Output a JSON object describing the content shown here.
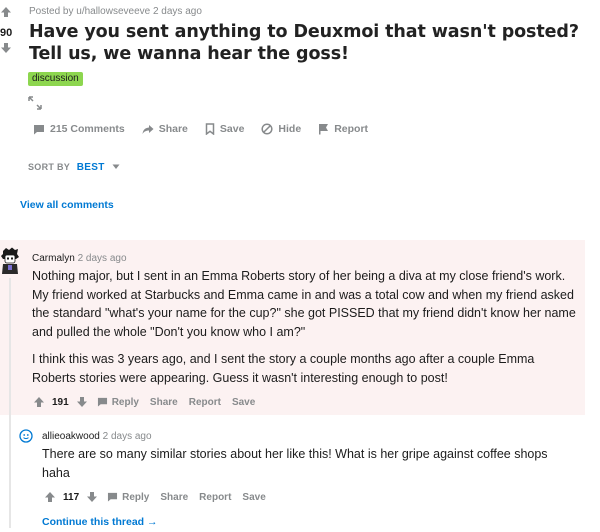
{
  "post": {
    "score": "90",
    "meta": "Posted by u/hallowseveeve 2 days ago",
    "title": "Have you sent anything to Deuxmoi that wasn't posted? Tell us, we wanna hear the goss!",
    "flair": "discussion",
    "flair_color": "#8dd64f",
    "actions": {
      "comments": "215 Comments",
      "share": "Share",
      "save": "Save",
      "hide": "Hide",
      "report": "Report"
    }
  },
  "sort": {
    "label": "SORT BY",
    "value": "BEST"
  },
  "view_all": "View all comments",
  "comments": [
    {
      "user": "Carmalyn",
      "time": "2 days ago",
      "paragraphs": [
        "Nothing major, but I sent in an Emma Roberts story of her being a diva at my close friend's work. My friend worked at Starbucks and Emma came in and was a total cow and when my friend asked the standard \"what's your name for the cup?\" she got PISSED that my friend didn't know her name and pulled the whole \"Don't you know who I am?\"",
        "I think this was 3 years ago, and I sent the story a couple months ago after a couple Emma Roberts stories were appearing. Guess it wasn't interesting enough to post!"
      ],
      "score": "191",
      "actions": {
        "reply": "Reply",
        "share": "Share",
        "report": "Report",
        "save": "Save"
      }
    },
    {
      "user": "allieoakwood",
      "time": "2 days ago",
      "paragraphs": [
        "There are so many similar stories about her like this! What is her gripe against coffee shops haha"
      ],
      "score": "117",
      "actions": {
        "reply": "Reply",
        "share": "Share",
        "report": "Report",
        "save": "Save"
      }
    }
  ],
  "continue_thread": "Continue this thread",
  "colors": {
    "link": "#0079d3",
    "muted": "#878a8c",
    "highlight": "#fcf2f2"
  }
}
